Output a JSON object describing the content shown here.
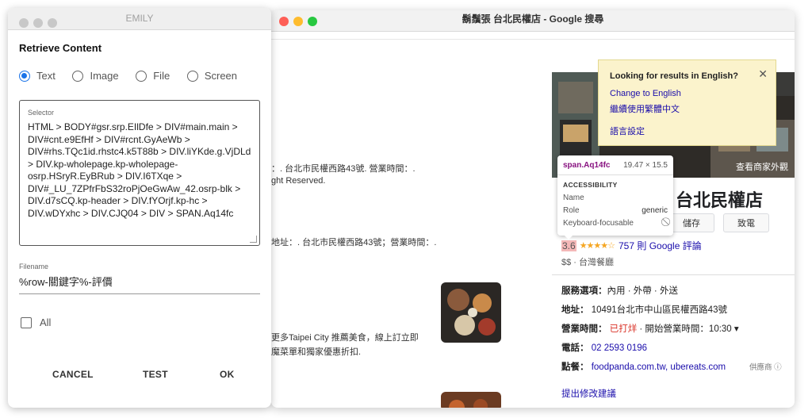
{
  "dialog": {
    "title": "EMILY",
    "heading": "Retrieve Content",
    "content_types": [
      {
        "label": "Text",
        "selected": true
      },
      {
        "label": "Image",
        "selected": false
      },
      {
        "label": "File",
        "selected": false
      },
      {
        "label": "Screen",
        "selected": false
      }
    ],
    "selector_label": "Selector",
    "selector_value": "HTML > BODY#gsr.srp.EIlDfe > DIV#main.main > DIV#cnt.e9EfHf > DIV#rcnt.GyAeWb > DIV#rhs.TQc1id.rhstc4.k5T88b > DIV.liYKde.g.VjDLd > DIV.kp-wholepage.kp-wholepage-osrp.HSryR.EyBRub > DIV.I6TXqe > DIV#_LU_7ZPfrFbS32roPjOeGwAw_42.osrp-blk > DIV.d7sCQ.kp-header > DIV.fYOrjf.kp-hc > DIV.wDYxhc > DIV.CJQ04 > DIV > SPAN.Aq14fc",
    "filename_label": "Filename",
    "filename_value": "%row-關鍵字%-評價",
    "all_label": "All",
    "buttons": {
      "cancel": "CANCEL",
      "test": "TEST",
      "ok": "OK"
    }
  },
  "browser": {
    "title": "鬍鬚張 台北民權店 - Google 搜尋",
    "results": [
      "：. 台北市民權西路43號. 營業時間：.",
      "ght Reserved.",
      "地址：. 台北市民權西路43號；營業時間：.",
      "更多Taipei City 推薦美食，線上訂立即",
      "魔菜單和獨家優惠折扣."
    ],
    "panel": {
      "photo_caption": "查看商家外觀",
      "title": "台北民權店",
      "btn_save": "儲存",
      "btn_call": "致電",
      "rating": "3.6",
      "reviews": "757 則 Google 評論",
      "price": "$$",
      "category": "台灣餐廳",
      "services_label": "服務選項：",
      "services_value": "內用 · 外帶 · 外送",
      "address_label": "地址：",
      "address_value": "10491台北市中山區民權西路43號",
      "hours_label": "營業時間：",
      "hours_status": "已打烊",
      "hours_value": "· 開始營業時間：10:30 ▾",
      "phone_label": "電話：",
      "phone_value": "02 2593 0196",
      "order_label": "點餐：",
      "order_value": "foodpanda.com.tw, ubereats.com",
      "provider": "供應商 ⓘ",
      "suggest": "提出修改建議"
    },
    "lang_popup": {
      "title": "Looking for results in English?",
      "link_english": "Change to English",
      "link_chinese": "繼續使用繁體中文",
      "link_settings": "語言設定"
    },
    "inspector": {
      "element": "span.Aq14fc",
      "size": "19.47 × 15.5",
      "section": "ACCESSIBILITY",
      "name_label": "Name",
      "role_label": "Role",
      "role_value": "generic",
      "focus_label": "Keyboard-focusable",
      "focus_value": "⃠"
    }
  },
  "colors": {
    "accent": "#1a73e8",
    "link": "#1a0dab",
    "closed": "#d93025",
    "star": "#f5a623"
  }
}
